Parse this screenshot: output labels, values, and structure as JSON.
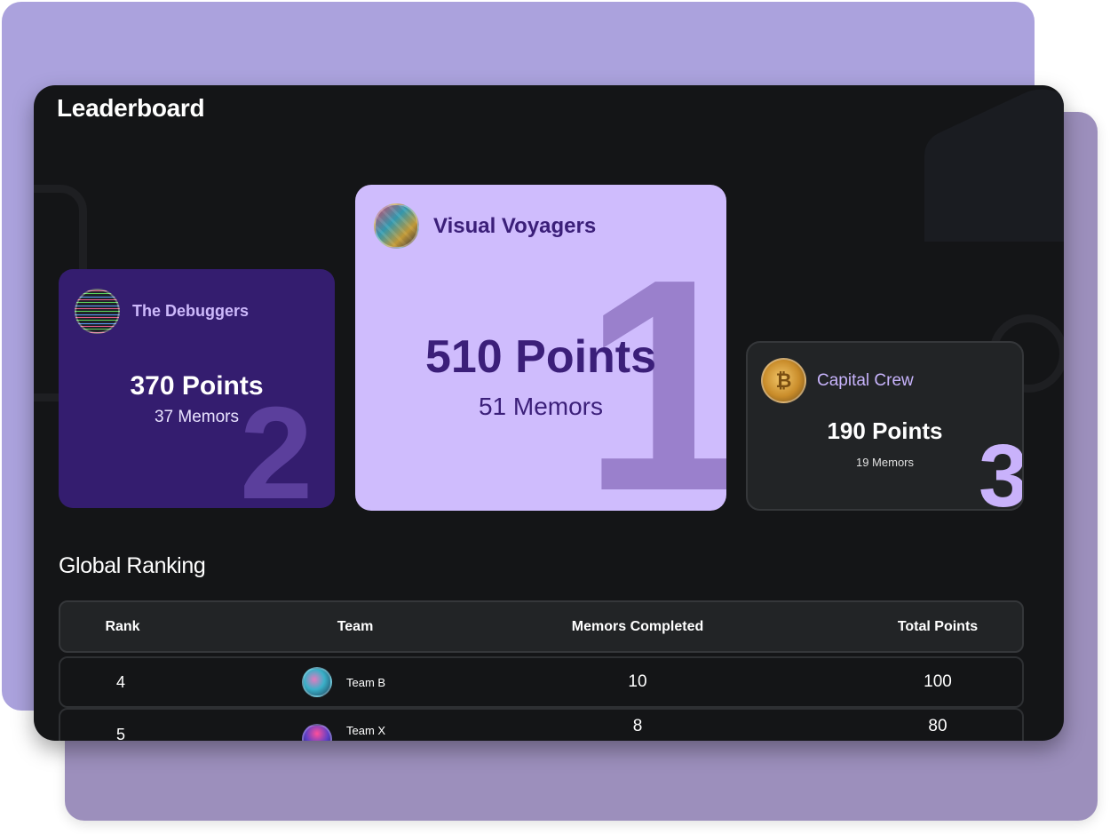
{
  "page": {
    "title": "Leaderboard"
  },
  "podium": [
    {
      "rank": "1",
      "team": "Visual Voyagers",
      "points": "510 Points",
      "memors": "51 Memors",
      "avatar": "team-avatar-image"
    },
    {
      "rank": "2",
      "team": "The Debuggers",
      "points": "370 Points",
      "memors": "37 Memors",
      "avatar": "team-avatar-image"
    },
    {
      "rank": "3",
      "team": "Capital Crew",
      "points": "190 Points",
      "memors": "19 Memors",
      "avatar": "bitcoin-coin-avatar"
    }
  ],
  "ranking": {
    "title": "Global Ranking",
    "columns": [
      "Rank",
      "Team",
      "Memors Completed",
      "Total Points"
    ],
    "rows": [
      {
        "rank": "4",
        "team": "Team B",
        "memors": "10",
        "points": "100"
      },
      {
        "rank": "5",
        "team": "Team X",
        "memors": "8",
        "points": "80"
      }
    ]
  },
  "colors": {
    "panel_bg": "#141517",
    "first_card_bg": "#cfbcfd",
    "second_card_bg": "#341d6f",
    "third_card_bg": "#222426",
    "accent_text": "#3b1f79"
  }
}
